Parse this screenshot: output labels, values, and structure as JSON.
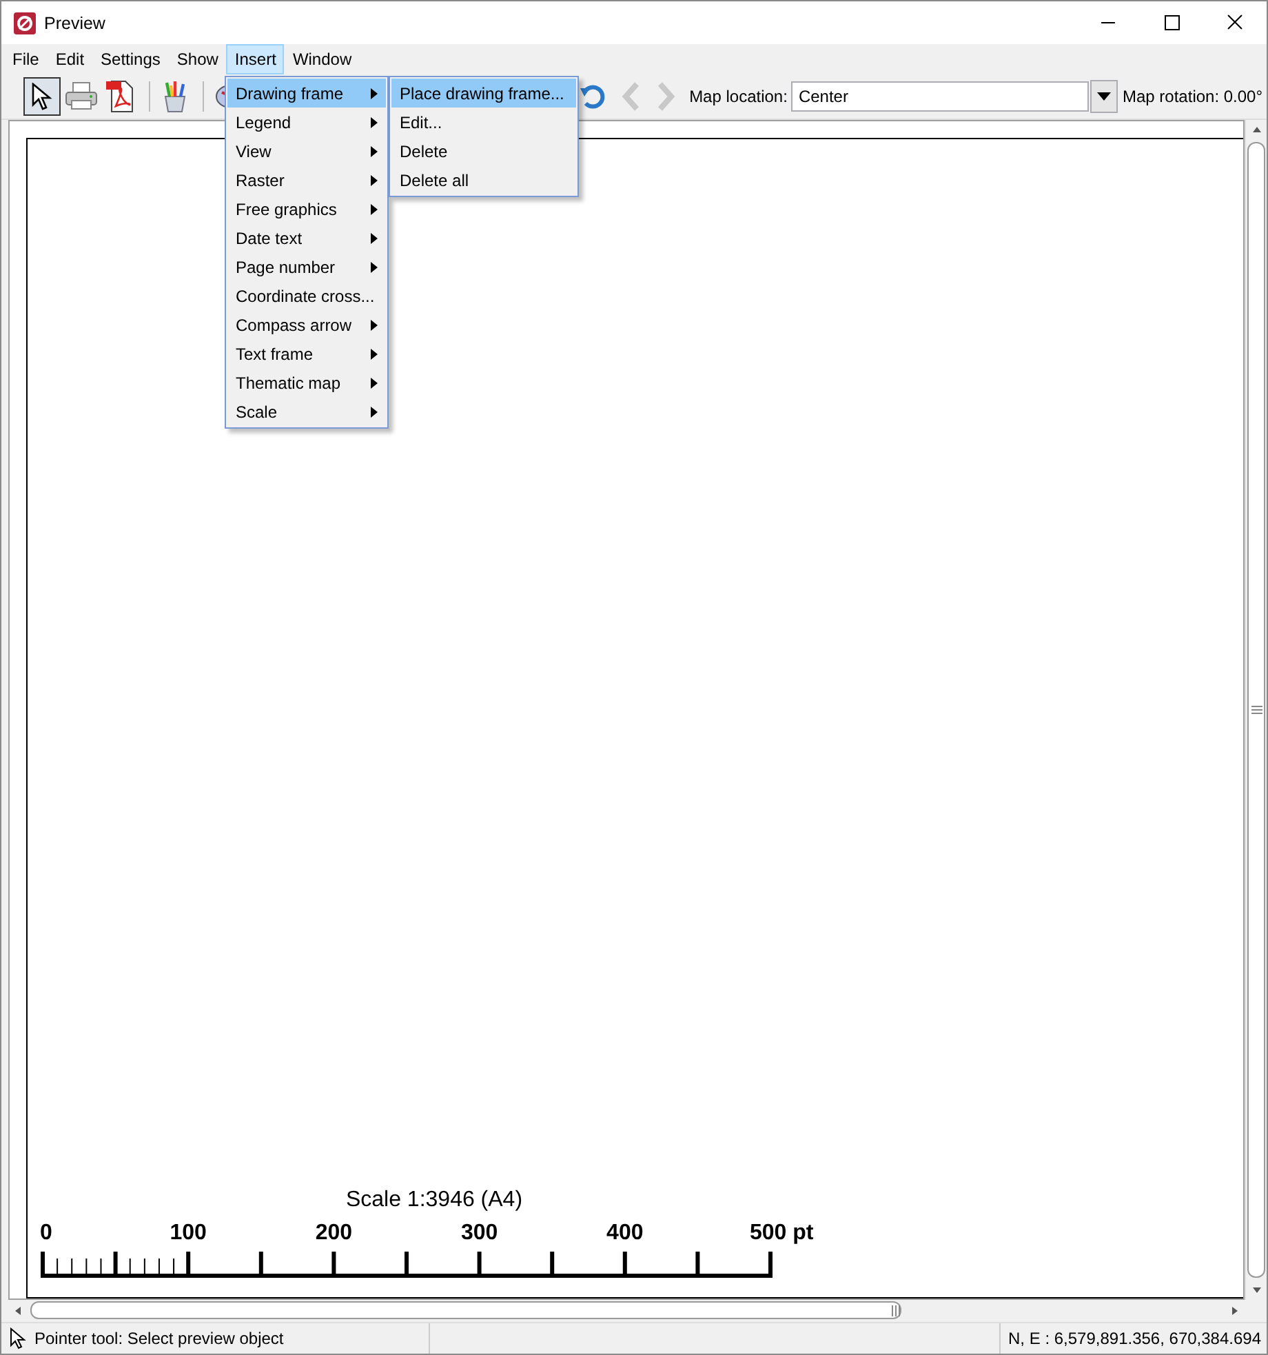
{
  "window": {
    "title": "Preview"
  },
  "menu_bar": [
    {
      "label": "File",
      "selected": false
    },
    {
      "label": "Edit",
      "selected": false
    },
    {
      "label": "Settings",
      "selected": false
    },
    {
      "label": "Show",
      "selected": false
    },
    {
      "label": "Insert",
      "selected": true
    },
    {
      "label": "Window",
      "selected": false
    }
  ],
  "toolbar": {
    "tools": [
      {
        "kind": "pointer",
        "selected": true
      },
      {
        "kind": "printer",
        "selected": false
      },
      {
        "kind": "pdf",
        "selected": false
      },
      {
        "kind": "pencils",
        "selected": false
      },
      {
        "kind": "compass",
        "selected": false
      },
      {
        "kind": "refresh",
        "selected": false
      }
    ],
    "nav": [
      {
        "kind": "back",
        "disabled": true
      },
      {
        "kind": "forward",
        "disabled": true
      }
    ],
    "map_location": {
      "label": "Map location:",
      "value": "Center"
    },
    "map_rotation": "Map rotation: 0.00°"
  },
  "insert_menu": [
    {
      "label": "Drawing frame",
      "has_submenu": true,
      "selected": true
    },
    {
      "label": "Legend",
      "has_submenu": true,
      "selected": false
    },
    {
      "label": "View",
      "has_submenu": true,
      "selected": false
    },
    {
      "label": "Raster",
      "has_submenu": true,
      "selected": false
    },
    {
      "label": "Free graphics",
      "has_submenu": true,
      "selected": false
    },
    {
      "label": "Date text",
      "has_submenu": true,
      "selected": false
    },
    {
      "label": "Page number",
      "has_submenu": true,
      "selected": false
    },
    {
      "label": "Coordinate cross...",
      "has_submenu": false,
      "selected": false
    },
    {
      "label": "Compass arrow",
      "has_submenu": true,
      "selected": false
    },
    {
      "label": "Text frame",
      "has_submenu": true,
      "selected": false
    },
    {
      "label": "Thematic map",
      "has_submenu": true,
      "selected": false
    },
    {
      "label": "Scale",
      "has_submenu": true,
      "selected": false
    }
  ],
  "drawing_frame_submenu": [
    {
      "label": "Place drawing frame...",
      "selected": true
    },
    {
      "label": "Edit...",
      "selected": false
    },
    {
      "label": "Delete",
      "selected": false
    },
    {
      "label": "Delete all",
      "selected": false
    }
  ],
  "page": {
    "scale_title": "Scale 1:3946 (A4)",
    "scale_labels": [
      "0",
      "100",
      "200",
      "300",
      "400",
      "500 pt"
    ]
  },
  "status_bar": {
    "hint": "Pointer tool: Select preview object",
    "coordinates": "N, E : 6,579,891.356, 670,384.694"
  }
}
